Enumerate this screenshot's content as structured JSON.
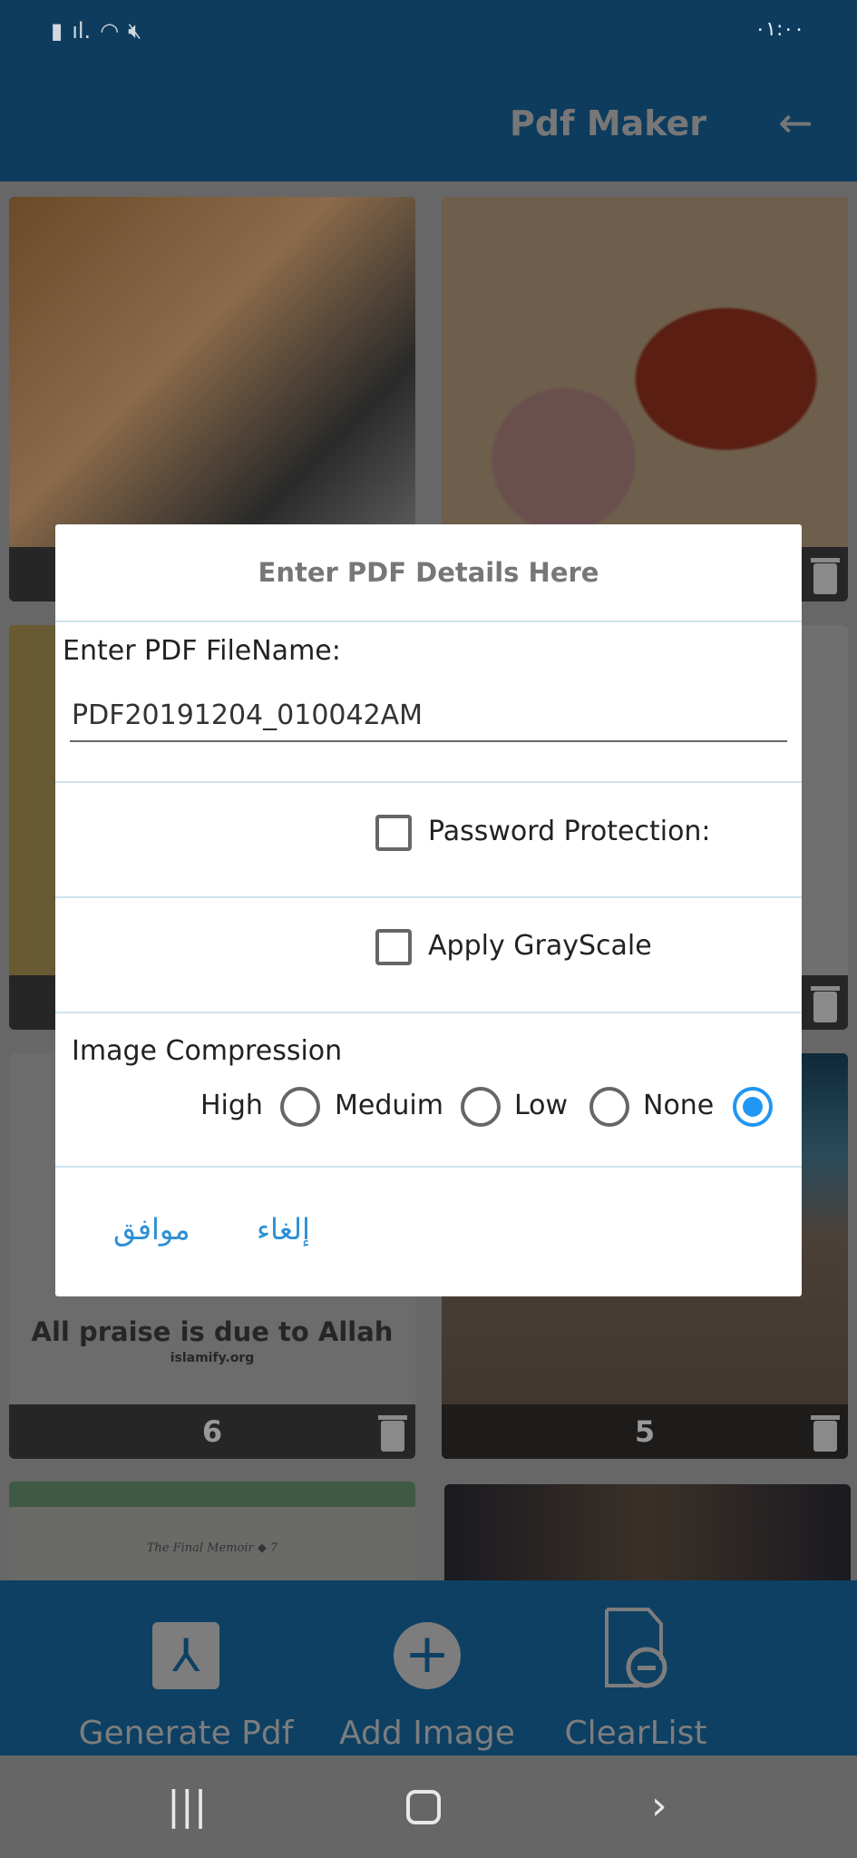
{
  "status_bar": {
    "time": "٠١:٠٠",
    "icons": [
      "battery-icon",
      "signal-icon",
      "wifi-icon",
      "mute-icon"
    ]
  },
  "app_bar": {
    "title": "Pdf Maker",
    "back_icon": "arrow-left-icon"
  },
  "cards": [
    {
      "label": ""
    },
    {
      "label": ""
    },
    {
      "label": ""
    },
    {
      "label": ""
    },
    {
      "label": "6",
      "caption": "All praise is due to Allah",
      "caption_sub": "islamify.org"
    },
    {
      "label": "5"
    },
    {
      "caption": "The Final Memoir ◆ 7"
    },
    {}
  ],
  "dialog": {
    "title": "Enter PDF Details Here",
    "filename_label": "Enter PDF FileName:",
    "filename_value": "PDF20191204_010042AM",
    "password_label": "Password Protection:",
    "password_checked": false,
    "grayscale_label": "Apply GrayScale",
    "grayscale_checked": false,
    "compression_label": "Image Compression",
    "options": [
      "High",
      "Meduim",
      "Low",
      "None"
    ],
    "selected": "None",
    "ok": "موافق",
    "cancel": "إلغاء",
    "accent": "#2196f3"
  },
  "bottom_bar": {
    "generate": "Generate Pdf",
    "add": "Add Image",
    "clear": "ClearList"
  }
}
